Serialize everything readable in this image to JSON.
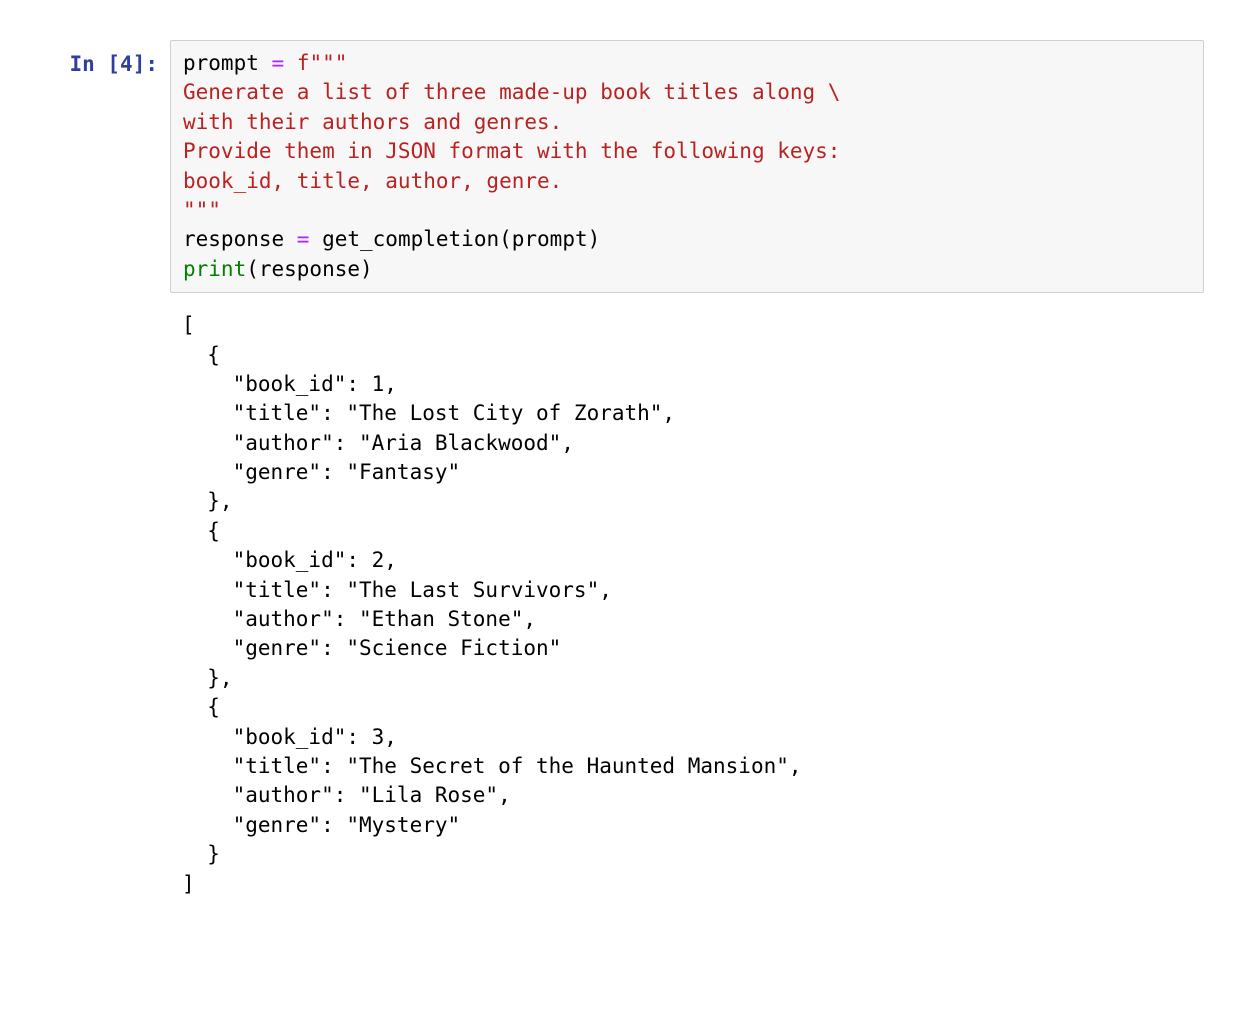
{
  "cell": {
    "promptLabel": "In [4]:",
    "code": {
      "l1": {
        "a": "prompt ",
        "b": "=",
        "c": " f",
        "d": "\"\"\""
      },
      "l2": "Generate a list of three made-up book titles along \\",
      "l3": "with their authors and genres.",
      "l4": "Provide them in JSON format with the following keys:",
      "l5": "book_id, title, author, genre.",
      "l6": "\"\"\"",
      "l7": {
        "a": "response ",
        "b": "=",
        "c": " get_completion(prompt)"
      },
      "l8": {
        "a": "print",
        "b": "(response)"
      }
    },
    "output": {
      "o1": "[",
      "o2": "  {",
      "o3": "    \"book_id\": 1,",
      "o4": "    \"title\": \"The Lost City of Zorath\",",
      "o5": "    \"author\": \"Aria Blackwood\",",
      "o6": "    \"genre\": \"Fantasy\"",
      "o7": "  },",
      "o8": "  {",
      "o9": "    \"book_id\": 2,",
      "o10": "    \"title\": \"The Last Survivors\",",
      "o11": "    \"author\": \"Ethan Stone\",",
      "o12": "    \"genre\": \"Science Fiction\"",
      "o13": "  },",
      "o14": "  {",
      "o15": "    \"book_id\": 3,",
      "o16": "    \"title\": \"The Secret of the Haunted Mansion\",",
      "o17": "    \"author\": \"Lila Rose\",",
      "o18": "    \"genre\": \"Mystery\"",
      "o19": "  }",
      "o20": "]"
    }
  }
}
